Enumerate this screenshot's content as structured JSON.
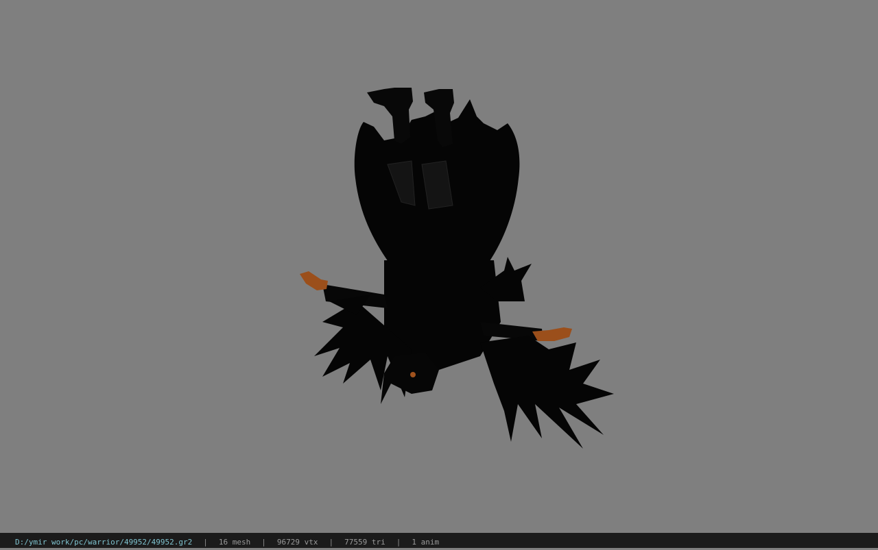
{
  "viewport": {
    "background_color": "#7f7f7f",
    "model_colors": {
      "body": "#060606",
      "detail": "#1a1a1a",
      "hands": "#a0521d"
    }
  },
  "status_bar": {
    "file_path": "D:/ymir work/pc/warrior/49952/49952.gr2",
    "separator": "|",
    "mesh_count": "16 mesh",
    "vertex_count": "96729 vtx",
    "triangle_count": "77559 tri",
    "animation_count": "1 anim",
    "path_color": "#7fc3cf"
  }
}
